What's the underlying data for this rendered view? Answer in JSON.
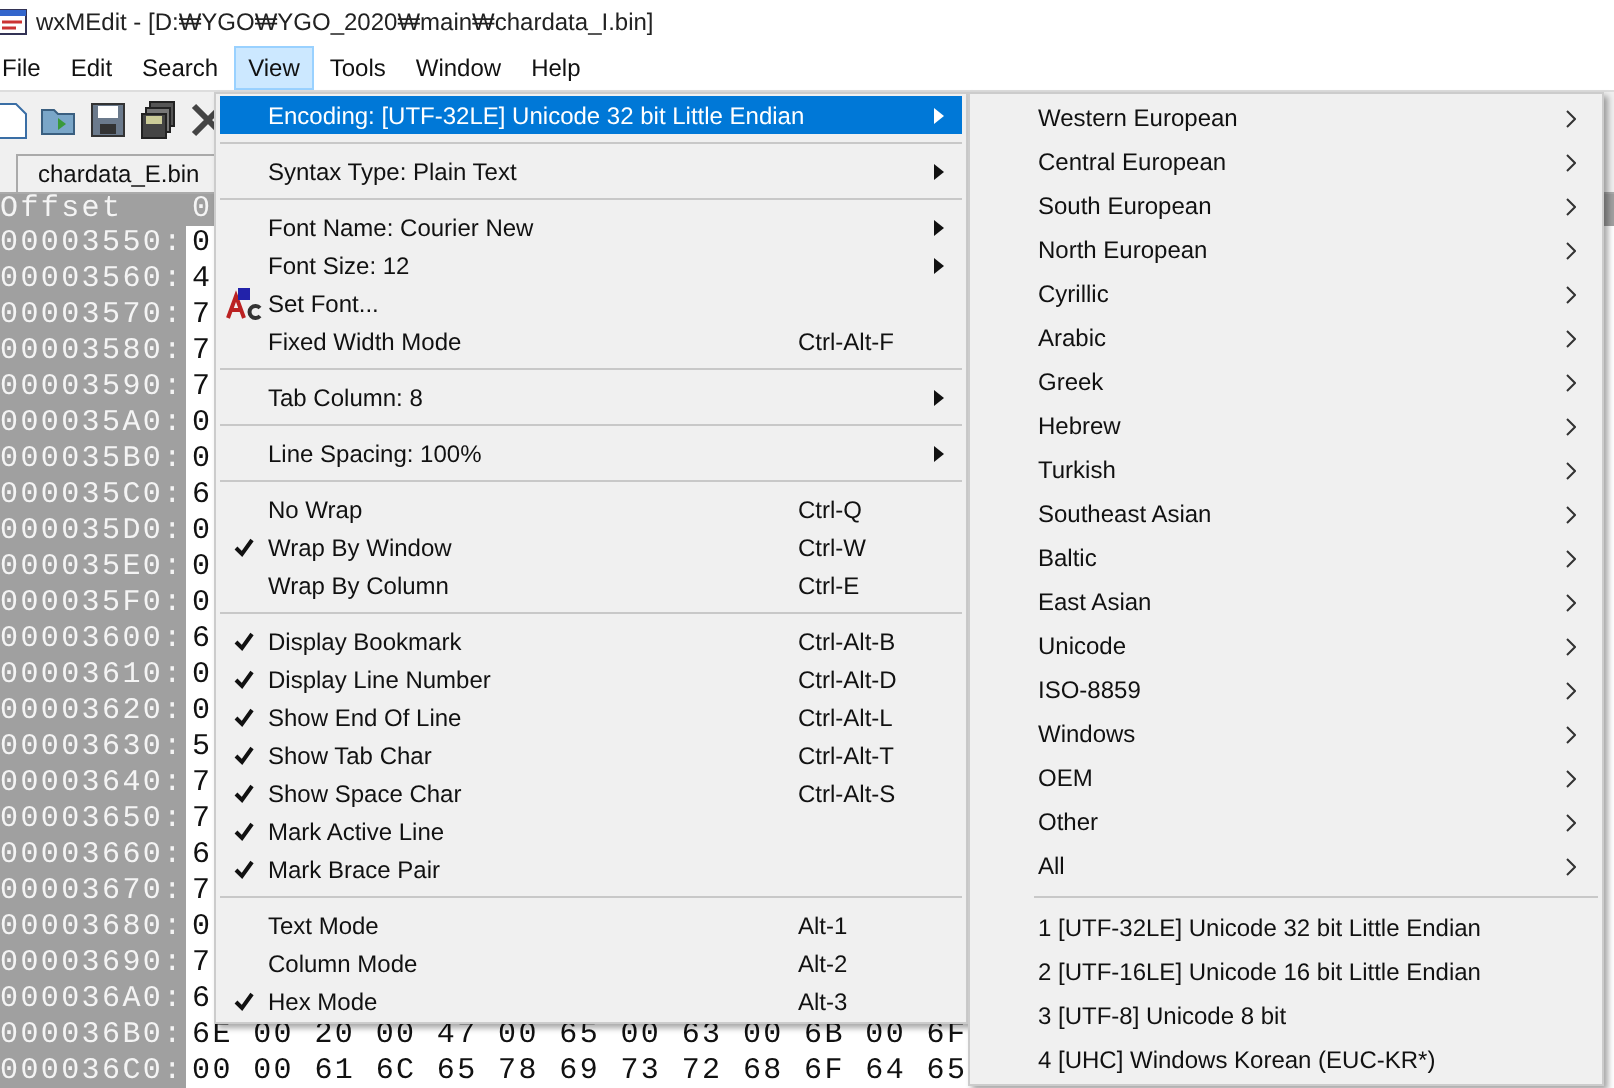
{
  "window": {
    "title": "wxMEdit - [D:₩YGO₩YGO_2020₩main₩chardata_I.bin]"
  },
  "menubar": [
    {
      "label": "File",
      "selected": false
    },
    {
      "label": "Edit",
      "selected": false
    },
    {
      "label": "Search",
      "selected": false
    },
    {
      "label": "View",
      "selected": true
    },
    {
      "label": "Tools",
      "selected": false
    },
    {
      "label": "Window",
      "selected": false
    },
    {
      "label": "Help",
      "selected": false
    }
  ],
  "tabs": [
    {
      "label": "chardata_E.bin",
      "selected": false
    }
  ],
  "editor": {
    "header": {
      "offset": "Offset",
      "column_1": "0"
    },
    "rows": [
      {
        "offset": "00003550:",
        "hex": "0"
      },
      {
        "offset": "00003560:",
        "hex": "4"
      },
      {
        "offset": "00003570:",
        "hex": "7"
      },
      {
        "offset": "00003580:",
        "hex": "7"
      },
      {
        "offset": "00003590:",
        "hex": "7"
      },
      {
        "offset": "000035A0:",
        "hex": "0"
      },
      {
        "offset": "000035B0:",
        "hex": "0"
      },
      {
        "offset": "000035C0:",
        "hex": "6"
      },
      {
        "offset": "000035D0:",
        "hex": "0"
      },
      {
        "offset": "000035E0:",
        "hex": "0"
      },
      {
        "offset": "000035F0:",
        "hex": "0"
      },
      {
        "offset": "00003600:",
        "hex": "6"
      },
      {
        "offset": "00003610:",
        "hex": "0"
      },
      {
        "offset": "00003620:",
        "hex": "0"
      },
      {
        "offset": "00003630:",
        "hex": "5"
      },
      {
        "offset": "00003640:",
        "hex": "7"
      },
      {
        "offset": "00003650:",
        "hex": "7"
      },
      {
        "offset": "00003660:",
        "hex": "6"
      },
      {
        "offset": "00003670:",
        "hex": "7"
      },
      {
        "offset": "00003680:",
        "hex": "0"
      },
      {
        "offset": "00003690:",
        "hex": "7"
      },
      {
        "offset": "000036A0:",
        "hex": "6"
      },
      {
        "offset": "000036B0:",
        "hex": "6E 00 20 00 47 00 65 00 63 00 6B 00 6F"
      },
      {
        "offset": "000036C0:",
        "hex": "00 00 61 6C 65 78 69 73 72 68 6F 64 65"
      }
    ]
  },
  "view_menu": [
    {
      "kind": "item",
      "label": "Encoding: [UTF-32LE] Unicode 32 bit Little Endian",
      "submenu": true,
      "selected": true
    },
    {
      "kind": "separator"
    },
    {
      "kind": "item",
      "label": "Syntax Type: Plain Text",
      "submenu": true,
      "selected": false
    },
    {
      "kind": "separator"
    },
    {
      "kind": "item",
      "label": "Font Name: Courier New",
      "submenu": true,
      "selected": false
    },
    {
      "kind": "item",
      "label": "Font Size: 12",
      "submenu": true,
      "selected": false
    },
    {
      "kind": "font",
      "label": "Set Font...",
      "selected": false
    },
    {
      "kind": "item",
      "label": "Fixed Width Mode",
      "shortcut": "Ctrl-Alt-F",
      "checked": false,
      "selected": false
    },
    {
      "kind": "separator"
    },
    {
      "kind": "item",
      "label": "Tab Column: 8",
      "submenu": true,
      "selected": false
    },
    {
      "kind": "separator"
    },
    {
      "kind": "item",
      "label": "Line Spacing: 100%",
      "submenu": true,
      "selected": false
    },
    {
      "kind": "separator"
    },
    {
      "kind": "item",
      "label": "No Wrap",
      "shortcut": "Ctrl-Q",
      "checked": false,
      "selected": false
    },
    {
      "kind": "item",
      "label": "Wrap By Window",
      "shortcut": "Ctrl-W",
      "checked": true,
      "selected": false
    },
    {
      "kind": "item",
      "label": "Wrap By Column",
      "shortcut": "Ctrl-E",
      "checked": false,
      "selected": false
    },
    {
      "kind": "separator"
    },
    {
      "kind": "item",
      "label": "Display Bookmark",
      "shortcut": "Ctrl-Alt-B",
      "checked": true,
      "selected": false
    },
    {
      "kind": "item",
      "label": "Display Line Number",
      "shortcut": "Ctrl-Alt-D",
      "checked": true,
      "selected": false
    },
    {
      "kind": "item",
      "label": "Show End Of Line",
      "shortcut": "Ctrl-Alt-L",
      "checked": true,
      "selected": false
    },
    {
      "kind": "item",
      "label": "Show Tab Char",
      "shortcut": "Ctrl-Alt-T",
      "checked": true,
      "selected": false
    },
    {
      "kind": "item",
      "label": "Show Space Char",
      "shortcut": "Ctrl-Alt-S",
      "checked": true,
      "selected": false
    },
    {
      "kind": "item",
      "label": "Mark Active Line",
      "checked": true,
      "selected": false
    },
    {
      "kind": "item",
      "label": "Mark Brace Pair",
      "checked": true,
      "selected": false
    },
    {
      "kind": "separator"
    },
    {
      "kind": "item",
      "label": "Text Mode",
      "shortcut": "Alt-1",
      "checked": false,
      "selected": false
    },
    {
      "kind": "item",
      "label": "Column Mode",
      "shortcut": "Alt-2",
      "checked": false,
      "selected": false
    },
    {
      "kind": "item",
      "label": "Hex Mode",
      "shortcut": "Alt-3",
      "checked": true,
      "selected": false
    }
  ],
  "encoding_submenu": [
    {
      "kind": "item",
      "label": "Western European",
      "submenu": true
    },
    {
      "kind": "item",
      "label": "Central European",
      "submenu": true
    },
    {
      "kind": "item",
      "label": "South European",
      "submenu": true
    },
    {
      "kind": "item",
      "label": "North European",
      "submenu": true
    },
    {
      "kind": "item",
      "label": "Cyrillic",
      "submenu": true
    },
    {
      "kind": "item",
      "label": "Arabic",
      "submenu": true
    },
    {
      "kind": "item",
      "label": "Greek",
      "submenu": true
    },
    {
      "kind": "item",
      "label": "Hebrew",
      "submenu": true
    },
    {
      "kind": "item",
      "label": "Turkish",
      "submenu": true
    },
    {
      "kind": "item",
      "label": "Southeast Asian",
      "submenu": true
    },
    {
      "kind": "item",
      "label": "Baltic",
      "submenu": true
    },
    {
      "kind": "item",
      "label": "East Asian",
      "submenu": true
    },
    {
      "kind": "item",
      "label": "Unicode",
      "submenu": true
    },
    {
      "kind": "item",
      "label": "ISO-8859",
      "submenu": true
    },
    {
      "kind": "item",
      "label": "Windows",
      "submenu": true
    },
    {
      "kind": "item",
      "label": "OEM",
      "submenu": true
    },
    {
      "kind": "item",
      "label": "Other",
      "submenu": true
    },
    {
      "kind": "item",
      "label": "All",
      "submenu": true
    },
    {
      "kind": "separator"
    },
    {
      "kind": "item",
      "label": "1 [UTF-32LE] Unicode 32 bit Little Endian",
      "submenu": false
    },
    {
      "kind": "item",
      "label": "2 [UTF-16LE] Unicode 16 bit Little Endian",
      "submenu": false
    },
    {
      "kind": "item",
      "label": "3 [UTF-8] Unicode 8 bit",
      "submenu": false
    },
    {
      "kind": "item",
      "label": "4 [UHC] Windows Korean (EUC-KR*)",
      "submenu": false
    }
  ]
}
